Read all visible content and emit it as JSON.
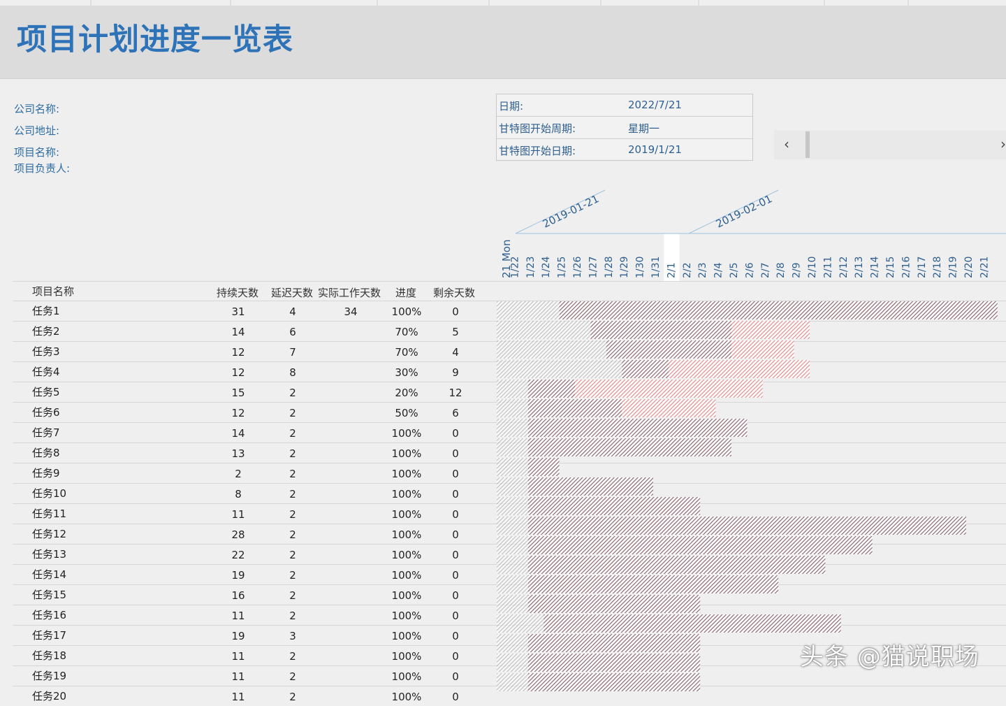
{
  "title": "项目计划进度一览表",
  "company": {
    "name_label": "公司名称:",
    "address_label": "公司地址:",
    "project_label": "项目名称:",
    "manager_label": "项目负责人:"
  },
  "info_box": {
    "date_label": "日期:",
    "date_value": "2022/7/21",
    "week_label": "甘特图开始周期:",
    "week_value": "星期一",
    "start_label": "甘特图开始日期:",
    "start_value": "2019/1/21"
  },
  "scrollbar": {
    "left": "‹",
    "right": "›"
  },
  "gantt": {
    "week_labels": [
      "2019-01-21",
      "2019-02-01"
    ],
    "first_day_label": "21 Mon",
    "day_labels": [
      "1/22",
      "1/23",
      "1/24",
      "1/25",
      "1/26",
      "1/27",
      "1/28",
      "1/29",
      "1/30",
      "1/31",
      "2/1",
      "2/2",
      "2/3",
      "2/4",
      "2/5",
      "2/6",
      "2/7",
      "2/8",
      "2/9",
      "2/10",
      "2/11",
      "2/12",
      "2/13",
      "2/14",
      "2/15",
      "2/16",
      "2/17",
      "2/18",
      "2/19",
      "2/20",
      "2/21"
    ],
    "today_label": "2/1",
    "colors": {
      "done": "#8c6670",
      "remaining": "#e58a8a",
      "offset": "#d2d2d2"
    },
    "bars": [
      {
        "offset": 4,
        "done": 28,
        "remaining": 0
      },
      {
        "offset": 6,
        "done": 9,
        "remaining": 5
      },
      {
        "offset": 7,
        "done": 8,
        "remaining": 4
      },
      {
        "offset": 8,
        "done": 3,
        "remaining": 9
      },
      {
        "offset": 2,
        "done": 3,
        "remaining": 12
      },
      {
        "offset": 2,
        "done": 6,
        "remaining": 6
      },
      {
        "offset": 2,
        "done": 14,
        "remaining": 0
      },
      {
        "offset": 2,
        "done": 13,
        "remaining": 0
      },
      {
        "offset": 2,
        "done": 2,
        "remaining": 0
      },
      {
        "offset": 2,
        "done": 8,
        "remaining": 0
      },
      {
        "offset": 2,
        "done": 11,
        "remaining": 0
      },
      {
        "offset": 2,
        "done": 28,
        "remaining": 0
      },
      {
        "offset": 2,
        "done": 22,
        "remaining": 0
      },
      {
        "offset": 2,
        "done": 19,
        "remaining": 0
      },
      {
        "offset": 2,
        "done": 16,
        "remaining": 0
      },
      {
        "offset": 2,
        "done": 11,
        "remaining": 0
      },
      {
        "offset": 3,
        "done": 19,
        "remaining": 0
      },
      {
        "offset": 2,
        "done": 11,
        "remaining": 0
      },
      {
        "offset": 2,
        "done": 11,
        "remaining": 0
      },
      {
        "offset": 2,
        "done": 11,
        "remaining": 0
      }
    ]
  },
  "table": {
    "headers": {
      "name": "项目名称",
      "duration": "持续天数",
      "delay": "延迟天数",
      "actual": "实际工作天数",
      "progress": "进度",
      "remaining": "剩余天数"
    },
    "rows": [
      {
        "name": "任务1",
        "duration": "31",
        "delay": "4",
        "actual": "34",
        "progress": "100%",
        "remaining": "0"
      },
      {
        "name": "任务2",
        "duration": "14",
        "delay": "6",
        "actual": "",
        "progress": "70%",
        "remaining": "5"
      },
      {
        "name": "任务3",
        "duration": "12",
        "delay": "7",
        "actual": "",
        "progress": "70%",
        "remaining": "4"
      },
      {
        "name": "任务4",
        "duration": "12",
        "delay": "8",
        "actual": "",
        "progress": "30%",
        "remaining": "9"
      },
      {
        "name": "任务5",
        "duration": "15",
        "delay": "2",
        "actual": "",
        "progress": "20%",
        "remaining": "12"
      },
      {
        "name": "任务6",
        "duration": "12",
        "delay": "2",
        "actual": "",
        "progress": "50%",
        "remaining": "6"
      },
      {
        "name": "任务7",
        "duration": "14",
        "delay": "2",
        "actual": "",
        "progress": "100%",
        "remaining": "0"
      },
      {
        "name": "任务8",
        "duration": "13",
        "delay": "2",
        "actual": "",
        "progress": "100%",
        "remaining": "0"
      },
      {
        "name": "任务9",
        "duration": "2",
        "delay": "2",
        "actual": "",
        "progress": "100%",
        "remaining": "0"
      },
      {
        "name": "任务10",
        "duration": "8",
        "delay": "2",
        "actual": "",
        "progress": "100%",
        "remaining": "0"
      },
      {
        "name": "任务11",
        "duration": "11",
        "delay": "2",
        "actual": "",
        "progress": "100%",
        "remaining": "0"
      },
      {
        "name": "任务12",
        "duration": "28",
        "delay": "2",
        "actual": "",
        "progress": "100%",
        "remaining": "0"
      },
      {
        "name": "任务13",
        "duration": "22",
        "delay": "2",
        "actual": "",
        "progress": "100%",
        "remaining": "0"
      },
      {
        "name": "任务14",
        "duration": "19",
        "delay": "2",
        "actual": "",
        "progress": "100%",
        "remaining": "0"
      },
      {
        "name": "任务15",
        "duration": "16",
        "delay": "2",
        "actual": "",
        "progress": "100%",
        "remaining": "0"
      },
      {
        "name": "任务16",
        "duration": "11",
        "delay": "2",
        "actual": "",
        "progress": "100%",
        "remaining": "0"
      },
      {
        "name": "任务17",
        "duration": "19",
        "delay": "3",
        "actual": "",
        "progress": "100%",
        "remaining": "0"
      },
      {
        "name": "任务18",
        "duration": "11",
        "delay": "2",
        "actual": "",
        "progress": "100%",
        "remaining": "0"
      },
      {
        "name": "任务19",
        "duration": "11",
        "delay": "2",
        "actual": "",
        "progress": "100%",
        "remaining": "0"
      },
      {
        "name": "任务20",
        "duration": "11",
        "delay": "2",
        "actual": "",
        "progress": "100%",
        "remaining": "0"
      }
    ]
  },
  "watermark": "头条 @猫说职场"
}
